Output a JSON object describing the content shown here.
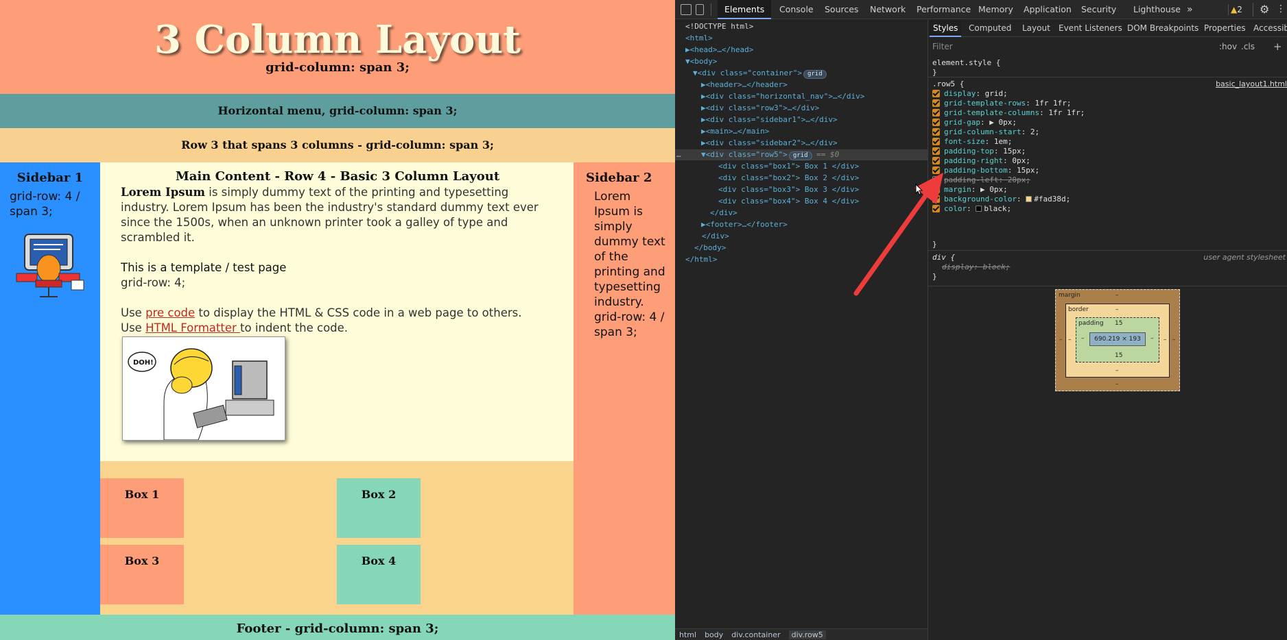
{
  "page": {
    "header_title": "3 Column Layout",
    "header_sub": "grid-column: span 3;",
    "nav_text": "Horizontal menu, grid-column: span 3;",
    "row3_text": "Row 3 that spans 3 columns - grid-column: span 3;",
    "sidebar1": {
      "title": "Sidebar 1",
      "text": "grid-row: 4 / span 3;"
    },
    "main": {
      "title": "Main Content - Row 4 - Basic 3 Column Layout",
      "lorem_bold": "Lorem Ipsum",
      "lorem_rest": " is simply dummy text of the printing and typesetting industry. Lorem Ipsum has been the industry's standard dummy text ever since the 1500s, when an unknown printer took a galley of type and scrambled it.",
      "template_title": "This is a template / test page",
      "template_row": "grid-row: 4;",
      "use1_a": "Use ",
      "use1_link": "pre code",
      "use1_b": " to display the HTML & CSS code in a web page to others.",
      "use2_a": "Use ",
      "use2_link": "HTML Formatter ",
      "use2_b": "to indent the code.",
      "image_text": "DOH!"
    },
    "boxes": [
      "Box 1",
      "Box 2",
      "Box 3",
      "Box 4"
    ],
    "sidebar2": {
      "title": "Sidebar 2",
      "text": "Lorem Ipsum is simply dummy text of the printing and typesetting industry. grid-row: 4 / span 3;"
    },
    "footer_text": "Footer - grid-column: span 3;"
  },
  "devtools": {
    "tabs": [
      "Elements",
      "Console",
      "Sources",
      "Network",
      "Performance",
      "Memory",
      "Application",
      "Security",
      "Lighthouse"
    ],
    "more": "»",
    "warnings": "2",
    "dom": [
      {
        "t": "<!DOCTYPE html>"
      },
      {
        "t": "<html>"
      },
      {
        "t": "▶<head>…</head>"
      },
      {
        "t": "▼<body>"
      },
      {
        "t": "▼<div class=\"container\">",
        "badge": "grid"
      },
      {
        "t": "▶<header>…</header>"
      },
      {
        "t": "▶<div class=\"horizontal_nav\">…</div>"
      },
      {
        "t": "▶<div class=\"row3\">…</div>"
      },
      {
        "t": "▶<div class=\"sidebar1\">…</div>"
      },
      {
        "t": "▶<main>…</main>"
      },
      {
        "t": "▶<div class=\"sidebar2\">…</div>"
      },
      {
        "t": "▼<div class=\"row5\">",
        "badge": "grid",
        "eq": "== $0"
      },
      {
        "t": "<div class=\"box1\"> Box 1 </div>"
      },
      {
        "t": "<div class=\"box2\"> Box 2 </div>"
      },
      {
        "t": "<div class=\"box3\"> Box 3 </div>"
      },
      {
        "t": "<div class=\"box4\"> Box 4 </div>"
      },
      {
        "t": "</div>"
      },
      {
        "t": "▶<footer>…</footer>"
      },
      {
        "t": "</div>"
      },
      {
        "t": "</body>"
      },
      {
        "t": "</html>"
      }
    ],
    "dots": "…",
    "breadcrumbs": [
      "html",
      "body",
      "div.container",
      "div.row5"
    ],
    "styles_tabs": [
      "Styles",
      "Computed",
      "Layout",
      "Event Listeners",
      "DOM Breakpoints",
      "Properties",
      "Accessibility"
    ],
    "filter_placeholder": "Filter",
    "hov": ":hov",
    "cls": ".cls",
    "plus": "+",
    "element_style": "element.style {",
    "close_brace": "}",
    "row5_selector": ".row5 {",
    "row5_source": "basic_layout1.html",
    "row5_props": [
      {
        "n": "display",
        "v": "grid;"
      },
      {
        "n": "grid-template-rows",
        "v": "1fr 1fr;"
      },
      {
        "n": "grid-template-columns",
        "v": "1fr 1fr;"
      },
      {
        "n": "grid-gap",
        "v": "▶ 0px;"
      },
      {
        "n": "grid-column-start",
        "v": "2;"
      },
      {
        "n": "font-size",
        "v": "1em;"
      },
      {
        "n": "padding-top",
        "v": "15px;"
      },
      {
        "n": "padding-right",
        "v": "0px;"
      },
      {
        "n": "padding-bottom",
        "v": "15px;"
      },
      {
        "n": "padding-left",
        "v": "20px;",
        "off": true
      },
      {
        "n": "margin",
        "v": "▶ 0px;"
      },
      {
        "n": "background-color",
        "v": "#fad38d;",
        "swatch": "#fad38d"
      },
      {
        "n": "color",
        "v": "black;",
        "swatch": "#000000"
      }
    ],
    "ua_selector": "div {",
    "ua_source": "user agent stylesheet",
    "ua_prop": {
      "n": "display",
      "v": "block;"
    },
    "box_model": {
      "margin": "margin",
      "border": "border",
      "padding": "padding",
      "dash": "–",
      "padding_top": "15",
      "padding_bottom": "15",
      "content": "690.219 × 193"
    }
  }
}
